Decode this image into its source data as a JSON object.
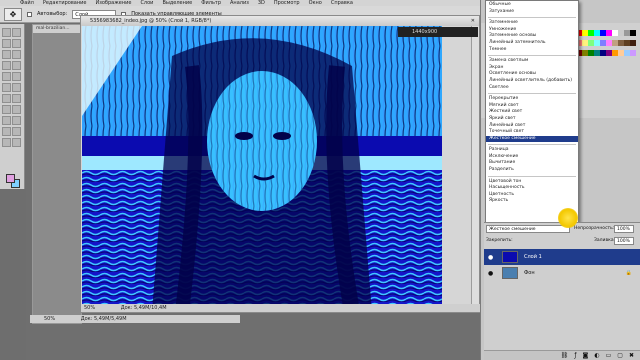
{
  "app": {
    "menu": [
      "Файл",
      "Редактирование",
      "Изображение",
      "Слои",
      "Выделение",
      "Фильтр",
      "Анализ",
      "3D",
      "Просмотр",
      "Окно",
      "Справка"
    ]
  },
  "options_bar": {
    "auto_select_label": "Автовыбор:",
    "auto_select_value": "Слой",
    "show_controls_label": "Показать управляющие элементы"
  },
  "document": {
    "title": "5356983682_indeo.jpg @ 50% (Слой 1, RGB/8*)",
    "status": "50%",
    "doc_size": "Док: 5,49M/10,4M",
    "info": "1440x900"
  },
  "background_document": {
    "title": "mal-brazilian...",
    "status": "50%",
    "doc_size": "Док: 5,49M/5,49M"
  },
  "blend_menu": {
    "items": [
      {
        "label": "Обычные",
        "sel": false
      },
      {
        "label": "Затухание",
        "sel": false
      },
      {
        "sep": true
      },
      {
        "label": "Затемнение",
        "sel": false
      },
      {
        "label": "Умножение",
        "sel": false
      },
      {
        "label": "Затемнение основы",
        "sel": false
      },
      {
        "label": "Линейный затемнитель",
        "sel": false
      },
      {
        "label": "Темнее",
        "sel": false
      },
      {
        "sep": true
      },
      {
        "label": "Замена светлым",
        "sel": false
      },
      {
        "label": "Экран",
        "sel": false
      },
      {
        "label": "Осветление основы",
        "sel": false
      },
      {
        "label": "Линейный осветлитель (добавить)",
        "sel": false
      },
      {
        "label": "Светлее",
        "sel": false
      },
      {
        "sep": true
      },
      {
        "label": "Перекрытие",
        "sel": false
      },
      {
        "label": "Мягкий свет",
        "sel": false
      },
      {
        "label": "Жесткий свет",
        "sel": false
      },
      {
        "label": "Яркий свет",
        "sel": false
      },
      {
        "label": "Линейный свет",
        "sel": false
      },
      {
        "label": "Точечный свет",
        "sel": false
      },
      {
        "label": "Жесткое смешение",
        "sel": true
      },
      {
        "sep": true
      },
      {
        "label": "Разница",
        "sel": false
      },
      {
        "label": "Исключение",
        "sel": false
      },
      {
        "label": "Вычитание",
        "sel": false
      },
      {
        "label": "Разделить",
        "sel": false
      },
      {
        "sep": true
      },
      {
        "label": "Цветовой тон",
        "sel": false
      },
      {
        "label": "Насыщенность",
        "sel": false
      },
      {
        "label": "Цветность",
        "sel": false
      },
      {
        "label": "Яркость",
        "sel": false
      }
    ]
  },
  "layers_panel": {
    "blend_value": "Жесткое смешение",
    "opacity_label": "Непрозрачность:",
    "opacity_value": "100%",
    "lock_label": "Закрепить:",
    "fill_label": "Заливка:",
    "fill_value": "100%",
    "layers": [
      {
        "name": "Слой 1",
        "active": true
      },
      {
        "name": "Фон",
        "active": false
      }
    ]
  },
  "colors": {
    "accent": "#1f3c8c",
    "foreground_swatch": "#e0a0e0",
    "background_swatch": "#7fd0ff"
  }
}
